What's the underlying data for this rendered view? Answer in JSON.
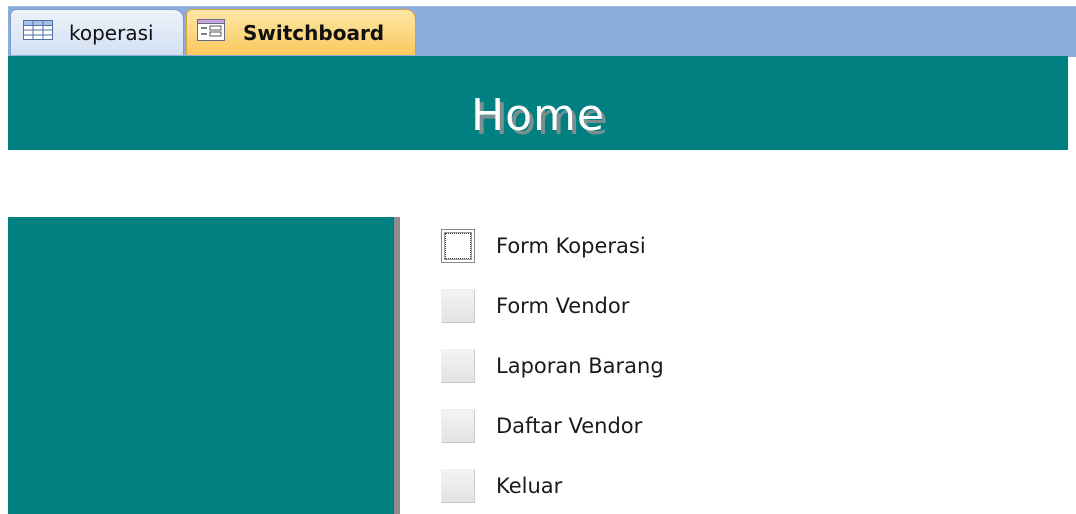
{
  "tabs": [
    {
      "label": "koperasi",
      "icon": "table-icon",
      "active": false
    },
    {
      "label": "Switchboard",
      "icon": "form-icon",
      "active": true
    }
  ],
  "header": {
    "title": "Home",
    "color": "#008080"
  },
  "menu": {
    "items": [
      {
        "label": "Form Koperasi",
        "focused": true
      },
      {
        "label": "Form Vendor",
        "focused": false
      },
      {
        "label": "Laporan Barang",
        "focused": false
      },
      {
        "label": "Daftar Vendor",
        "focused": false
      },
      {
        "label": "Keluar",
        "focused": false
      }
    ]
  },
  "colors": {
    "accent": "#008080",
    "tab_strip": "#8aaedb",
    "active_tab": "#f9c95c"
  }
}
